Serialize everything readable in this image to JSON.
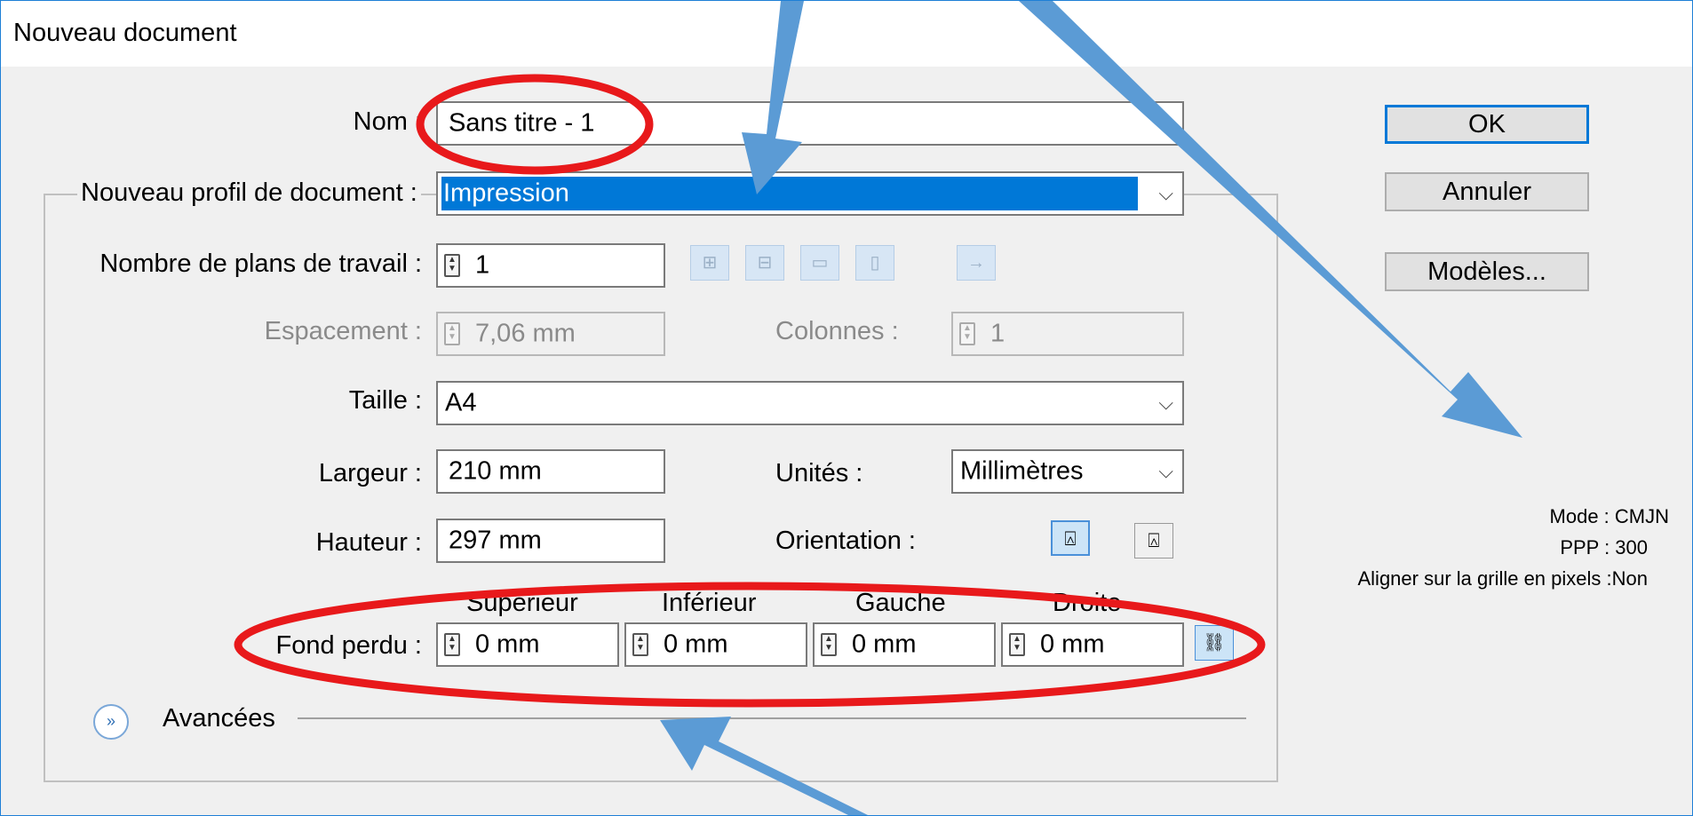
{
  "window": {
    "title": "Nouveau document"
  },
  "form": {
    "name_label": "Nom :",
    "name_value": "Sans titre - 1",
    "profile_label": "Nouveau profil de document :",
    "profile_value": "Impression",
    "artboards_label": "Nombre de plans de travail :",
    "artboards_value": "1",
    "spacing_label": "Espacement :",
    "spacing_value": "7,06 mm",
    "columns_label": "Colonnes :",
    "columns_value": "1",
    "size_label": "Taille :",
    "size_value": "A4",
    "width_label": "Largeur :",
    "width_value": "210 mm",
    "units_label": "Unités :",
    "units_value": "Millimètres",
    "height_label": "Hauteur :",
    "height_value": "297 mm",
    "orientation_label": "Orientation :",
    "bleed_label": "Fond perdu :",
    "bleed_headers": [
      "Supérieur",
      "Inférieur",
      "Gauche",
      "Droite"
    ],
    "bleed_values": [
      "0 mm",
      "0 mm",
      "0 mm",
      "0 mm"
    ],
    "advanced_label": "Avancées"
  },
  "buttons": {
    "ok": "OK",
    "cancel": "Annuler",
    "templates": "Modèles..."
  },
  "info": {
    "mode": "Mode : CMJN",
    "ppp": "PPP : 300",
    "pixel_grid": "Aligner sur la grille en pixels :Non"
  },
  "colors": {
    "selection": "#0078d7",
    "annotation_arrow": "#5b9bd5",
    "annotation_ellipse": "#e8191b"
  }
}
